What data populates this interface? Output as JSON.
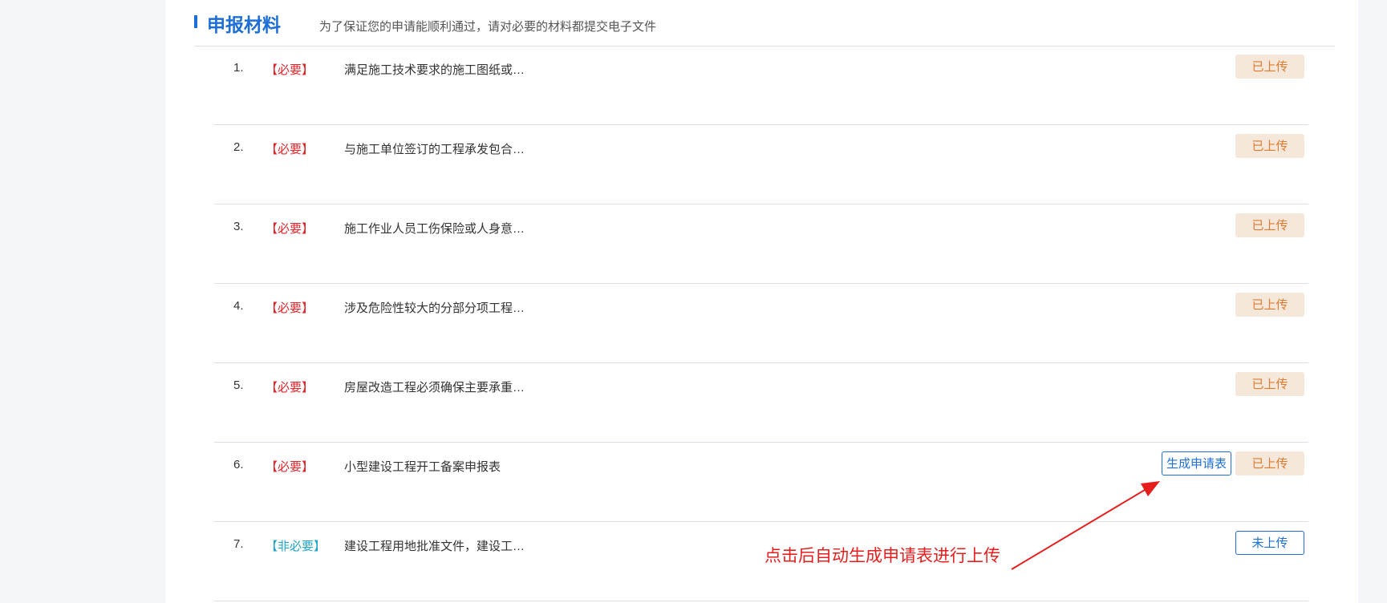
{
  "section": {
    "title": "申报材料",
    "subtitle": "为了保证您的申请能顺利通过，请对必要的材料都提交电子文件"
  },
  "materials": [
    {
      "index": "1.",
      "tag": "【必要】",
      "tag_type": "required",
      "name": "满足施工技术要求的施工图纸或…",
      "status": "已上传",
      "status_type": "uploaded"
    },
    {
      "index": "2.",
      "tag": "【必要】",
      "tag_type": "required",
      "name": "与施工单位签订的工程承发包合…",
      "status": "已上传",
      "status_type": "uploaded"
    },
    {
      "index": "3.",
      "tag": "【必要】",
      "tag_type": "required",
      "name": "施工作业人员工伤保险或人身意…",
      "status": "已上传",
      "status_type": "uploaded"
    },
    {
      "index": "4.",
      "tag": "【必要】",
      "tag_type": "required",
      "name": "涉及危险性较大的分部分项工程…",
      "status": "已上传",
      "status_type": "uploaded"
    },
    {
      "index": "5.",
      "tag": "【必要】",
      "tag_type": "required",
      "name": "房屋改造工程必须确保主要承重…",
      "status": "已上传",
      "status_type": "uploaded"
    },
    {
      "index": "6.",
      "tag": "【必要】",
      "tag_type": "required",
      "name": "小型建设工程开工备案申报表",
      "status": "已上传",
      "status_type": "uploaded",
      "generate_label": "生成申请表"
    },
    {
      "index": "7.",
      "tag": "【非必要】",
      "tag_type": "optional",
      "name": "建设工程用地批准文件，建设工…",
      "status": "未上传",
      "status_type": "not-uploaded"
    }
  ],
  "annotation": {
    "text": "点击后自动生成申请表进行上传",
    "color": "#e61e1e"
  },
  "colors": {
    "accent": "#1d6fd6",
    "required": "#e0262b",
    "optional": "#22a3c9",
    "uploaded_bg": "#f5e8db",
    "uploaded_text": "#e07a2e"
  }
}
